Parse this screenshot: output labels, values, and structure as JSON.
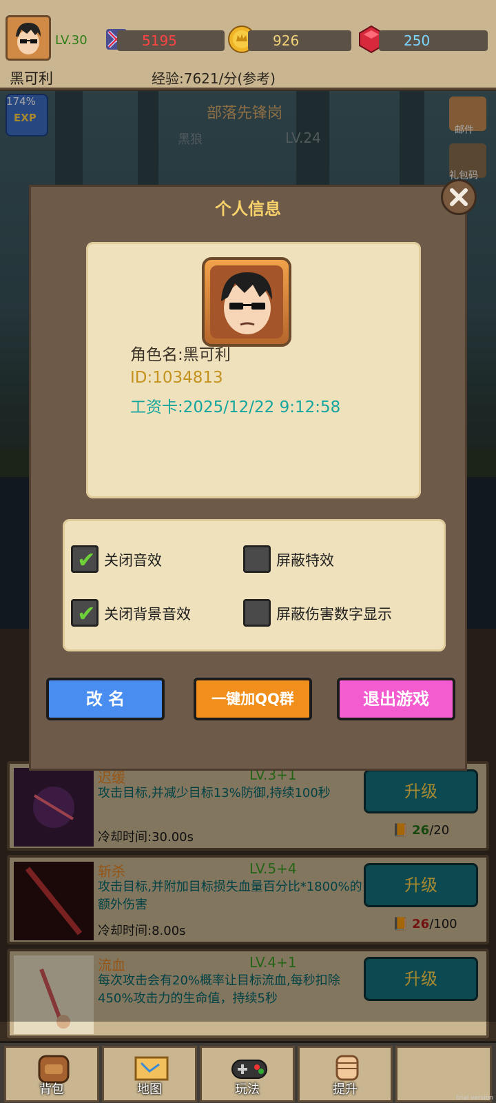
{
  "topbar": {
    "level": "LV.30",
    "combat_power": "5195",
    "gold": "926",
    "gems": "250",
    "player_name": "黑可利",
    "exp_rate": "经验:7621/分(参考)"
  },
  "scene": {
    "exp_boost_percent": "174%",
    "exp_badge_text": "EXP",
    "stage_name": "部落先锋岗",
    "enemy_name": "黑狼",
    "enemy_level": "LV.24",
    "mail_label": "邮件",
    "gift_label": "礼包码"
  },
  "modal": {
    "title": "个人信息",
    "character_name": "角色名:黑可利",
    "player_id": "ID:1034813",
    "wage_card": "工资卡:2025/12/22 9:12:58",
    "settings": [
      {
        "label": "关闭音效",
        "checked": true
      },
      {
        "label": "屏蔽特效",
        "checked": false
      },
      {
        "label": "关闭背景音效",
        "checked": true
      },
      {
        "label": "屏蔽伤害数字显示",
        "checked": false
      }
    ],
    "rename_label": "改 名",
    "join_qq_label": "一键加QQ群",
    "exit_label": "退出游戏",
    "check_glyph": "✔"
  },
  "skills": [
    {
      "name": "迟缓",
      "level": "LV.3+1",
      "desc": "攻击目标,并减少目标13%防御,持续100秒",
      "cooldown": "冷却时间:30.00s",
      "upgrade_label": "升级",
      "cost_have": "26",
      "cost_need": "/20"
    },
    {
      "name": "斩杀",
      "level": "LV.5+4",
      "desc": "攻击目标,并附加目标损失血量百分比*1800%的额外伤害",
      "cooldown": "冷却时间:8.00s",
      "upgrade_label": "升级",
      "cost_have": "26",
      "cost_need": "/100"
    },
    {
      "name": "流血",
      "level": "LV.4+1",
      "desc": "每次攻击会有20%概率让目标流血,每秒扣除450%攻击力的生命值，持续5秒",
      "cooldown": "",
      "upgrade_label": "升级",
      "cost_have": "",
      "cost_need": ""
    }
  ],
  "nav": {
    "bag": "背包",
    "map": "地图",
    "play": "玩法",
    "upgrade": "提升"
  },
  "watermark": "trial version"
}
